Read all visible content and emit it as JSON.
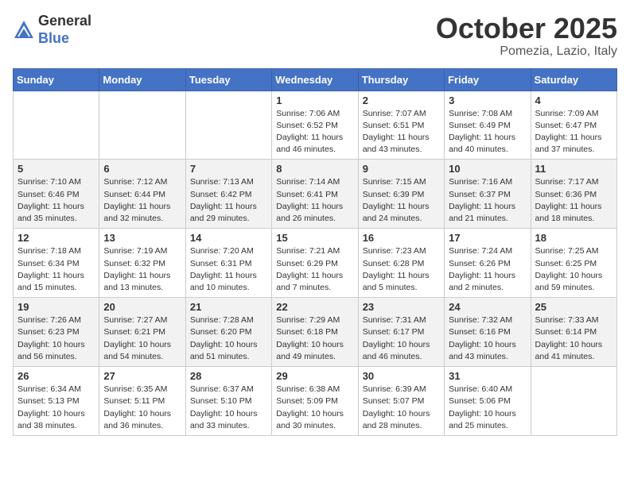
{
  "header": {
    "logo_general": "General",
    "logo_blue": "Blue",
    "month": "October 2025",
    "location": "Pomezia, Lazio, Italy"
  },
  "weekdays": [
    "Sunday",
    "Monday",
    "Tuesday",
    "Wednesday",
    "Thursday",
    "Friday",
    "Saturday"
  ],
  "weeks": [
    [
      {
        "day": "",
        "info": ""
      },
      {
        "day": "",
        "info": ""
      },
      {
        "day": "",
        "info": ""
      },
      {
        "day": "1",
        "info": "Sunrise: 7:06 AM\nSunset: 6:52 PM\nDaylight: 11 hours and 46 minutes."
      },
      {
        "day": "2",
        "info": "Sunrise: 7:07 AM\nSunset: 6:51 PM\nDaylight: 11 hours and 43 minutes."
      },
      {
        "day": "3",
        "info": "Sunrise: 7:08 AM\nSunset: 6:49 PM\nDaylight: 11 hours and 40 minutes."
      },
      {
        "day": "4",
        "info": "Sunrise: 7:09 AM\nSunset: 6:47 PM\nDaylight: 11 hours and 37 minutes."
      }
    ],
    [
      {
        "day": "5",
        "info": "Sunrise: 7:10 AM\nSunset: 6:46 PM\nDaylight: 11 hours and 35 minutes."
      },
      {
        "day": "6",
        "info": "Sunrise: 7:12 AM\nSunset: 6:44 PM\nDaylight: 11 hours and 32 minutes."
      },
      {
        "day": "7",
        "info": "Sunrise: 7:13 AM\nSunset: 6:42 PM\nDaylight: 11 hours and 29 minutes."
      },
      {
        "day": "8",
        "info": "Sunrise: 7:14 AM\nSunset: 6:41 PM\nDaylight: 11 hours and 26 minutes."
      },
      {
        "day": "9",
        "info": "Sunrise: 7:15 AM\nSunset: 6:39 PM\nDaylight: 11 hours and 24 minutes."
      },
      {
        "day": "10",
        "info": "Sunrise: 7:16 AM\nSunset: 6:37 PM\nDaylight: 11 hours and 21 minutes."
      },
      {
        "day": "11",
        "info": "Sunrise: 7:17 AM\nSunset: 6:36 PM\nDaylight: 11 hours and 18 minutes."
      }
    ],
    [
      {
        "day": "12",
        "info": "Sunrise: 7:18 AM\nSunset: 6:34 PM\nDaylight: 11 hours and 15 minutes."
      },
      {
        "day": "13",
        "info": "Sunrise: 7:19 AM\nSunset: 6:32 PM\nDaylight: 11 hours and 13 minutes."
      },
      {
        "day": "14",
        "info": "Sunrise: 7:20 AM\nSunset: 6:31 PM\nDaylight: 11 hours and 10 minutes."
      },
      {
        "day": "15",
        "info": "Sunrise: 7:21 AM\nSunset: 6:29 PM\nDaylight: 11 hours and 7 minutes."
      },
      {
        "day": "16",
        "info": "Sunrise: 7:23 AM\nSunset: 6:28 PM\nDaylight: 11 hours and 5 minutes."
      },
      {
        "day": "17",
        "info": "Sunrise: 7:24 AM\nSunset: 6:26 PM\nDaylight: 11 hours and 2 minutes."
      },
      {
        "day": "18",
        "info": "Sunrise: 7:25 AM\nSunset: 6:25 PM\nDaylight: 10 hours and 59 minutes."
      }
    ],
    [
      {
        "day": "19",
        "info": "Sunrise: 7:26 AM\nSunset: 6:23 PM\nDaylight: 10 hours and 56 minutes."
      },
      {
        "day": "20",
        "info": "Sunrise: 7:27 AM\nSunset: 6:21 PM\nDaylight: 10 hours and 54 minutes."
      },
      {
        "day": "21",
        "info": "Sunrise: 7:28 AM\nSunset: 6:20 PM\nDaylight: 10 hours and 51 minutes."
      },
      {
        "day": "22",
        "info": "Sunrise: 7:29 AM\nSunset: 6:18 PM\nDaylight: 10 hours and 49 minutes."
      },
      {
        "day": "23",
        "info": "Sunrise: 7:31 AM\nSunset: 6:17 PM\nDaylight: 10 hours and 46 minutes."
      },
      {
        "day": "24",
        "info": "Sunrise: 7:32 AM\nSunset: 6:16 PM\nDaylight: 10 hours and 43 minutes."
      },
      {
        "day": "25",
        "info": "Sunrise: 7:33 AM\nSunset: 6:14 PM\nDaylight: 10 hours and 41 minutes."
      }
    ],
    [
      {
        "day": "26",
        "info": "Sunrise: 6:34 AM\nSunset: 5:13 PM\nDaylight: 10 hours and 38 minutes."
      },
      {
        "day": "27",
        "info": "Sunrise: 6:35 AM\nSunset: 5:11 PM\nDaylight: 10 hours and 36 minutes."
      },
      {
        "day": "28",
        "info": "Sunrise: 6:37 AM\nSunset: 5:10 PM\nDaylight: 10 hours and 33 minutes."
      },
      {
        "day": "29",
        "info": "Sunrise: 6:38 AM\nSunset: 5:09 PM\nDaylight: 10 hours and 30 minutes."
      },
      {
        "day": "30",
        "info": "Sunrise: 6:39 AM\nSunset: 5:07 PM\nDaylight: 10 hours and 28 minutes."
      },
      {
        "day": "31",
        "info": "Sunrise: 6:40 AM\nSunset: 5:06 PM\nDaylight: 10 hours and 25 minutes."
      },
      {
        "day": "",
        "info": ""
      }
    ]
  ]
}
